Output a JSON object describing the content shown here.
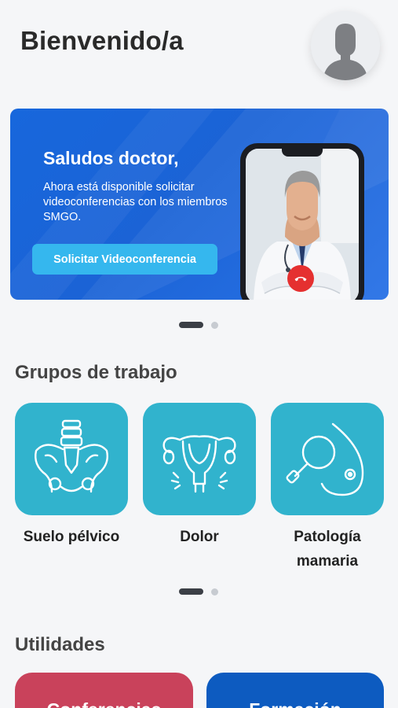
{
  "header": {
    "title": "Bienvenido/a",
    "avatar_icon": "user-avatar-icon"
  },
  "banner": {
    "heading": "Saludos doctor,",
    "text": "Ahora está disponible solicitar videoconferencias con los miembros SMGO.",
    "button_label": "Solicitar Videoconferencia",
    "background": "#1b63d6",
    "button_color": "#35b7ee",
    "pager": {
      "pages": 2,
      "current": 1
    }
  },
  "groups": {
    "title": "Grupos de trabajo",
    "tile_color": "#31b3cd",
    "items": [
      {
        "label": "Suelo pélvico",
        "icon": "pelvis-icon"
      },
      {
        "label": "Dolor",
        "icon": "uterus-pain-icon"
      },
      {
        "label": "Patología mamaria",
        "icon": "breast-exam-icon"
      }
    ],
    "pager": {
      "pages": 2,
      "current": 1
    }
  },
  "utilities": {
    "title": "Utilidades",
    "items": [
      {
        "label": "Conferencias",
        "color": "#c9425b"
      },
      {
        "label": "Formación",
        "color": "#0d5bc0"
      }
    ]
  }
}
